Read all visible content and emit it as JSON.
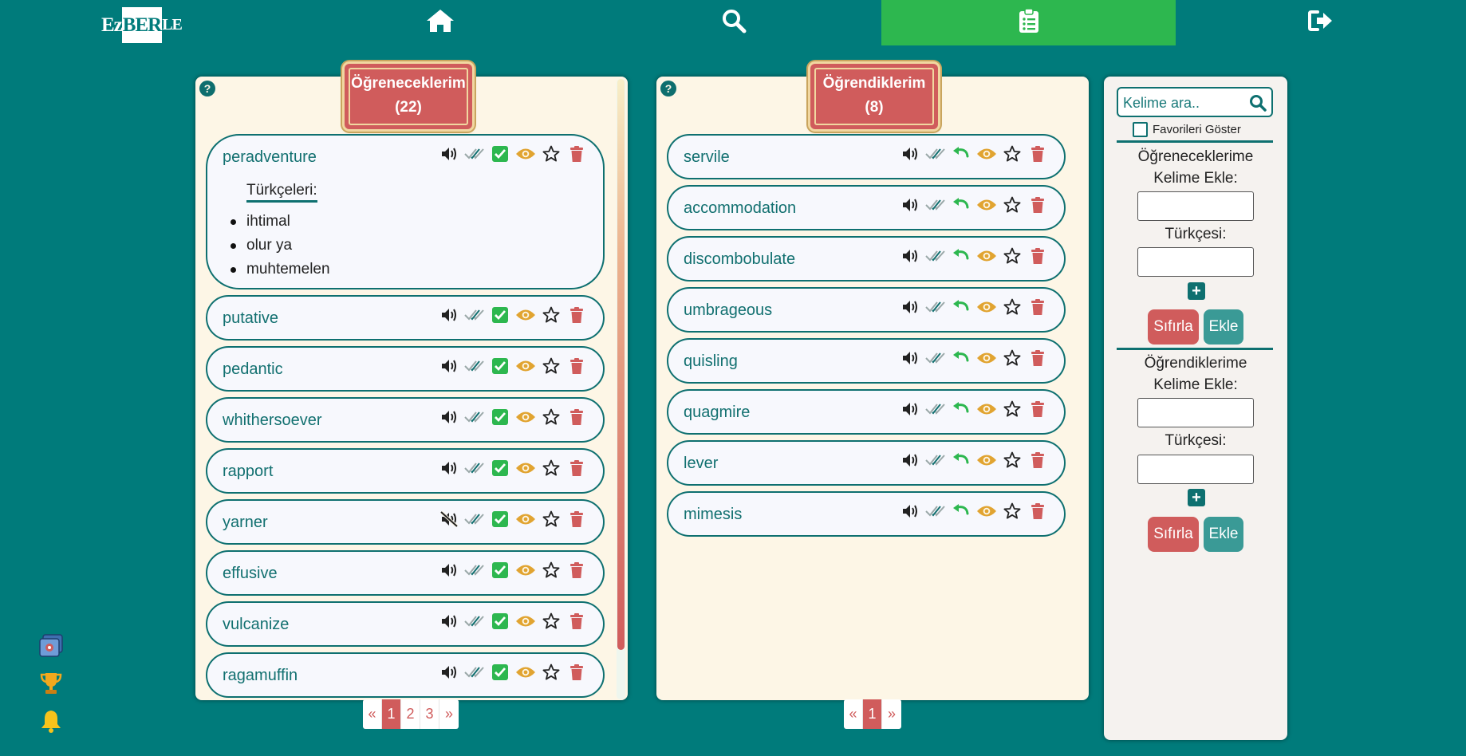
{
  "nav": {
    "logo": {
      "left": "Ez",
      "mid": "BER",
      "right": "LE"
    },
    "items": [
      {
        "name": "home",
        "icon": "home-icon"
      },
      {
        "name": "search",
        "icon": "search-icon"
      },
      {
        "name": "wordlist",
        "icon": "clipboard-list-icon",
        "active": true
      },
      {
        "name": "logout",
        "icon": "sign-out-icon"
      }
    ]
  },
  "to_learn": {
    "title": "Öğreneceklerim",
    "count": "(22)",
    "translations_heading": "Türkçeleri:",
    "words": [
      {
        "word": "peradventure",
        "translations": [
          "ihtimal",
          "olur ya",
          "muhtemelen"
        ],
        "expanded": true
      },
      {
        "word": "putative"
      },
      {
        "word": "pedantic"
      },
      {
        "word": "whithersoever"
      },
      {
        "word": "rapport"
      },
      {
        "word": "yarner",
        "muted": true
      },
      {
        "word": "effusive"
      },
      {
        "word": "vulcanize"
      },
      {
        "word": "ragamuffin"
      }
    ],
    "pagination": {
      "prev": "«",
      "pages": [
        "1",
        "2",
        "3"
      ],
      "active": "1",
      "next": "»"
    }
  },
  "learned": {
    "title": "Öğrendiklerim",
    "count": "(8)",
    "words": [
      {
        "word": "servile"
      },
      {
        "word": "accommodation"
      },
      {
        "word": "discombobulate"
      },
      {
        "word": "umbrageous"
      },
      {
        "word": "quisling"
      },
      {
        "word": "quagmire"
      },
      {
        "word": "lever"
      },
      {
        "word": "mimesis"
      }
    ],
    "pagination": {
      "prev": "«",
      "pages": [
        "1"
      ],
      "active": "1",
      "next": "»"
    }
  },
  "sidebar": {
    "search_placeholder": "Kelime ara..",
    "favorites_label": "Favorileri Göster",
    "add_to_learn": {
      "heading_1": "Öğreneceklerime",
      "heading_2": "Kelime Ekle:",
      "turkish_label": "Türkçesi:",
      "plus": "+",
      "reset_label": "Sıfırla",
      "add_label": "Ekle"
    },
    "add_learned": {
      "heading_1": "Öğrendiklerime",
      "heading_2": "Kelime Ekle:",
      "turkish_label": "Türkçesi:",
      "plus": "+",
      "reset_label": "Sıfırla",
      "add_label": "Ekle"
    }
  },
  "side_icons": [
    "profile-card-icon",
    "trophy-icon",
    "bell-icon"
  ],
  "help_symbol": "?",
  "colors": {
    "background": "#007b7b",
    "active_nav": "#2db74f",
    "panel": "#fdf6e6",
    "accent_red": "#d05c5c",
    "teal": "#0e7070",
    "eye": "#e1a431",
    "check_green": "#2db74f"
  }
}
